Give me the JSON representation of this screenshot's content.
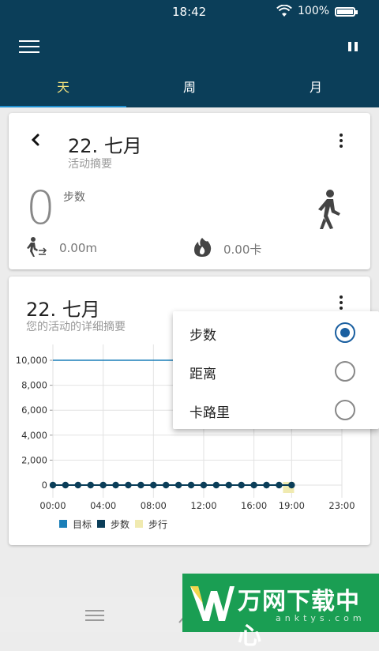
{
  "status_bar": {
    "time": "18:42",
    "battery_text": "100%"
  },
  "tabs": [
    "天",
    "周",
    "月"
  ],
  "active_tab": 0,
  "summary_card": {
    "date": "22. 七月",
    "subtitle": "活动摘要",
    "steps_value": "0",
    "steps_label": "步数",
    "distance": "0.00m",
    "calories": "0.00卡"
  },
  "detail_card": {
    "date": "22. 七月",
    "subtitle": "您的活动的详细摘要"
  },
  "popup_menu": {
    "options": [
      {
        "label": "步数",
        "selected": true
      },
      {
        "label": "距离",
        "selected": false
      },
      {
        "label": "卡路里",
        "selected": false
      }
    ]
  },
  "chart_data": {
    "type": "line",
    "y_ticks": [
      "0",
      "2,000",
      "4,000",
      "6,000",
      "8,000",
      "10,000"
    ],
    "x_ticks": [
      "00:00",
      "04:00",
      "08:00",
      "12:00",
      "16:00",
      "19:00",
      "23:00"
    ],
    "ylim": [
      0,
      10000
    ],
    "series": [
      {
        "name": "目标",
        "color": "#1a7fb8",
        "x": [
          0,
          23
        ],
        "y": [
          10000,
          10000
        ]
      },
      {
        "name": "步数",
        "color": "#0b3e59",
        "x": [
          0,
          1,
          2,
          3,
          4,
          5,
          6,
          7,
          8,
          9,
          10,
          11,
          12,
          13,
          14,
          15,
          16,
          17,
          18,
          19
        ],
        "y": [
          0,
          0,
          0,
          0,
          0,
          0,
          0,
          0,
          0,
          0,
          0,
          0,
          0,
          0,
          0,
          0,
          0,
          0,
          0,
          0
        ]
      },
      {
        "name": "步行",
        "color": "#f0eab0",
        "x": [
          18
        ],
        "y": [
          0
        ]
      }
    ],
    "legend": [
      "目标",
      "步数",
      "步行"
    ],
    "legend_colors": [
      "#1a7fb8",
      "#0b3e59",
      "#f0eab0"
    ],
    "grid": true
  },
  "watermark": {
    "text": "万网下载中心",
    "sub": "anktys.com"
  }
}
